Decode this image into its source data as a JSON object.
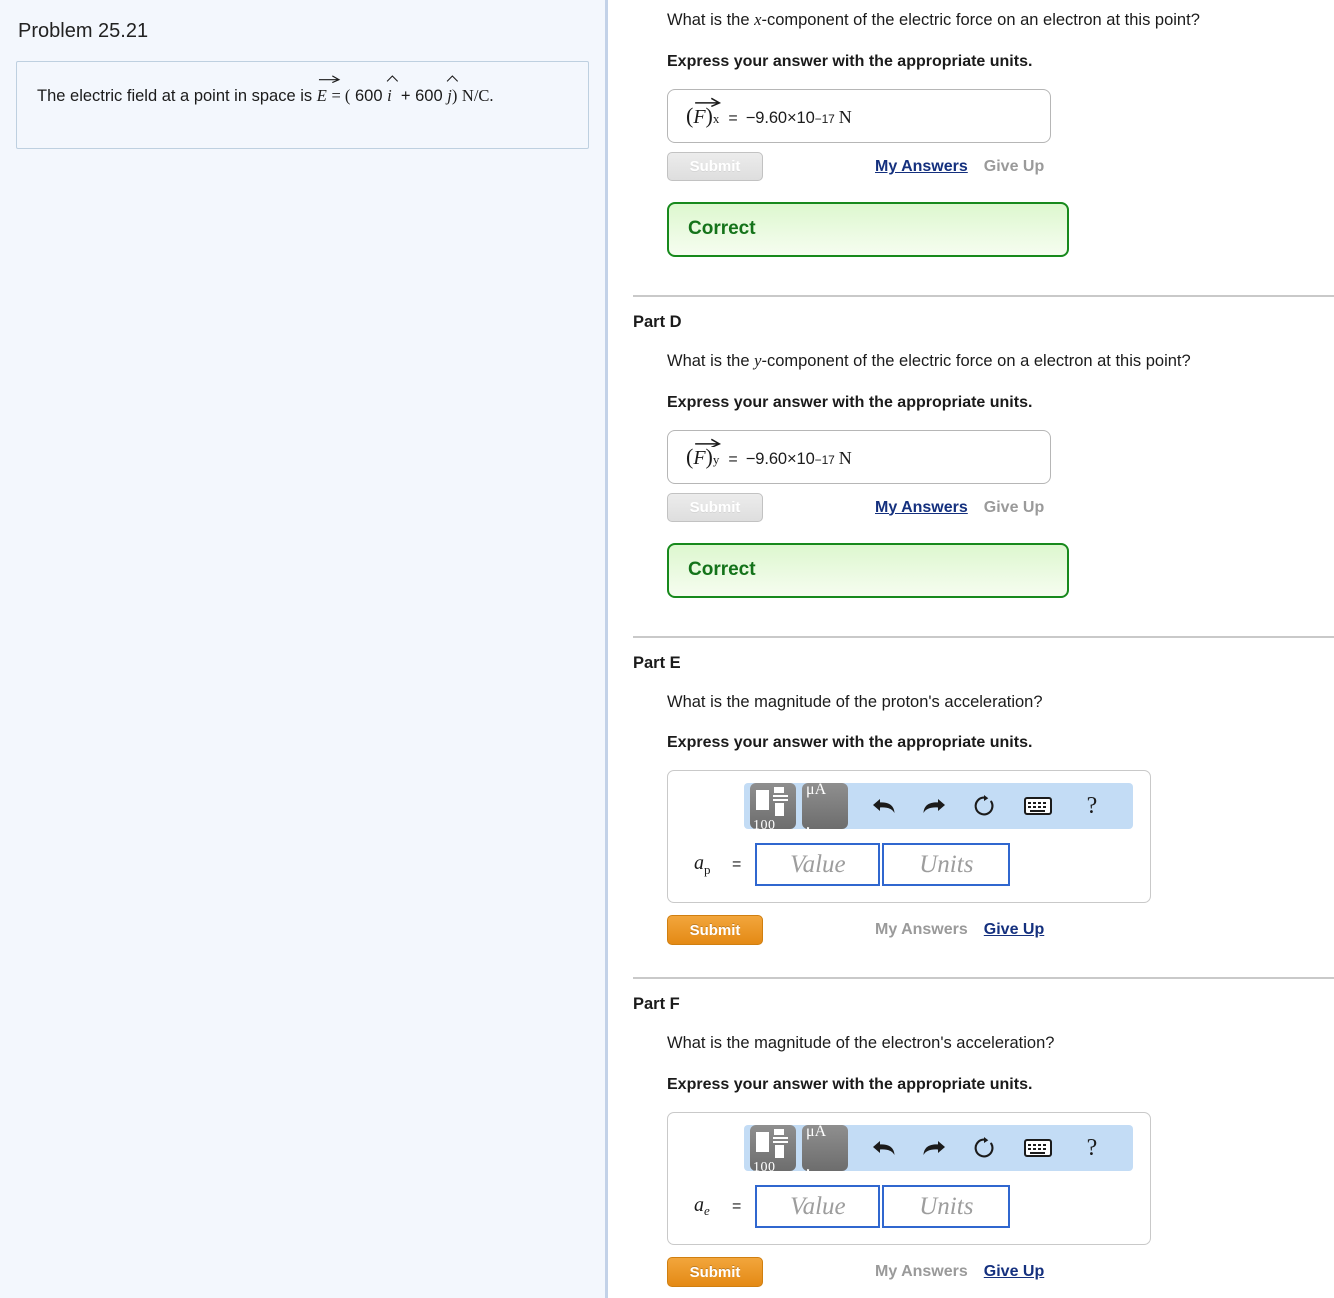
{
  "left": {
    "problem_title": "Problem 25.21",
    "problem_statement": {
      "lead": "The electric field at a point in space is",
      "vec_symbol": "E",
      "equals": "= (",
      "coef_i": "600",
      "unit_i": "i",
      "plus": "+",
      "coef_j": "600",
      "unit_j": "j",
      "close": ")",
      "units": "N/C",
      "period": "."
    }
  },
  "parts": [
    {
      "id": "part-c",
      "label": "",
      "show_divider": false,
      "show_label": false,
      "question": "What is the x-component of the electric force on an electron at this point?",
      "question_prefix": "What is the ",
      "question_var": "x",
      "question_suffix": "-component of the electric force on an electron at this point?",
      "instruction": "Express your answer with the appropriate units.",
      "state": "answered",
      "answer": {
        "symbol": "F",
        "subscript": "x",
        "equals": "=",
        "mantissa": "−9.60×10",
        "exponent": "−17",
        "unit": "N"
      },
      "submit_label": "Submit",
      "submit_enabled": false,
      "my_answers_label": "My Answers",
      "my_answers_enabled": true,
      "give_up_label": "Give Up",
      "give_up_enabled": false,
      "feedback": "Correct"
    },
    {
      "id": "part-d",
      "label": "Part D",
      "show_divider": true,
      "show_label": true,
      "question_prefix": "What is the ",
      "question_var": "y",
      "question_suffix": "-component of the electric force on a electron at this point?",
      "instruction": "Express your answer with the appropriate units.",
      "state": "answered",
      "answer": {
        "symbol": "F",
        "subscript": "y",
        "equals": "=",
        "mantissa": "−9.60×10",
        "exponent": "−17",
        "unit": "N"
      },
      "submit_label": "Submit",
      "submit_enabled": false,
      "my_answers_label": "My Answers",
      "my_answers_enabled": true,
      "give_up_label": "Give Up",
      "give_up_enabled": false,
      "feedback": "Correct"
    },
    {
      "id": "part-e",
      "label": "Part E",
      "show_divider": true,
      "show_label": true,
      "question_plain": "What is the magnitude of the proton's acceleration?",
      "instruction": "Express your answer with the appropriate units.",
      "state": "unanswered",
      "entry": {
        "var_base": "a",
        "var_sub": "p",
        "equals": "=",
        "value_placeholder": "Value",
        "units_placeholder": "Units"
      },
      "toolbar": {
        "template_icon": "math-template-icon",
        "template_caption": "100",
        "units_icon": "units-palette-icon",
        "units_caption": "μA",
        "undo_icon": "undo-icon",
        "redo_icon": "redo-icon",
        "reset_icon": "reset-icon",
        "keyboard_icon": "keyboard-icon",
        "help_icon": "help-icon",
        "help_glyph": "?"
      },
      "submit_label": "Submit",
      "submit_enabled": true,
      "my_answers_label": "My Answers",
      "my_answers_enabled": false,
      "give_up_label": "Give Up",
      "give_up_enabled": true
    },
    {
      "id": "part-f",
      "label": "Part F",
      "show_divider": true,
      "show_label": true,
      "question_plain": "What is the magnitude of the electron's acceleration?",
      "instruction": "Express your answer with the appropriate units.",
      "state": "unanswered",
      "entry": {
        "var_base": "a",
        "var_sub": "e",
        "equals": "=",
        "value_placeholder": "Value",
        "units_placeholder": "Units"
      },
      "toolbar": {
        "template_icon": "math-template-icon",
        "template_caption": "100",
        "units_icon": "units-palette-icon",
        "units_caption": "μA",
        "undo_icon": "undo-icon",
        "redo_icon": "redo-icon",
        "reset_icon": "reset-icon",
        "keyboard_icon": "keyboard-icon",
        "help_icon": "help-icon",
        "help_glyph": "?"
      },
      "submit_label": "Submit",
      "submit_enabled": true,
      "my_answers_label": "My Answers",
      "my_answers_enabled": false,
      "give_up_label": "Give Up",
      "give_up_enabled": true
    }
  ],
  "colors": {
    "panel_bg": "#f3f7fd",
    "panel_border": "#c3d2e8",
    "submit_orange": "#e48a15",
    "link_blue": "#14307e",
    "correct_green": "#17891c",
    "correct_bg": "#ddf7cf",
    "field_blue": "#3067cf",
    "toolbar_blue": "#c3dcf5"
  }
}
